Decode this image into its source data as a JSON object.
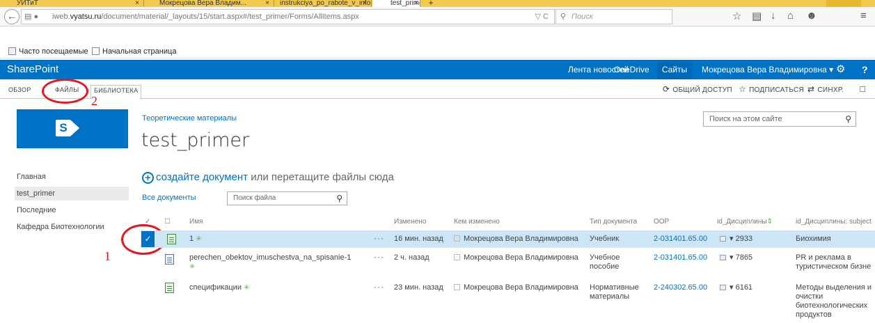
{
  "browser": {
    "tabs": [
      {
        "label": "УИТиТ",
        "close": "×"
      },
      {
        "label": "Мокрецова Вера Владим...",
        "close": "×"
      },
      {
        "label": "instrukciya_po_rabote_v_infor...",
        "close": "×"
      },
      {
        "label": "test_primer - Все докумен...",
        "close": "×",
        "active": true
      }
    ],
    "new_tab": "+",
    "url_prefix": "iweb.",
    "url_host": "vyatsu.ru",
    "url_path": "/document/material/_layouts/15/start.aspx#/test_primer/Forms/AllItems.aspx",
    "reload": "▽ C",
    "search_placeholder": "Поиск",
    "bookmarks": [
      "Часто посещаемые",
      "Начальная страница"
    ]
  },
  "suitebar": {
    "brand": "SharePoint",
    "links": [
      "Лента новостей",
      "OneDrive",
      "Сайты"
    ],
    "user": "Мокрецова Вера Владимировна ▾",
    "help": "?"
  },
  "ribbon": {
    "tabs": [
      "ОБЗОР",
      "ФАЙЛЫ",
      "БИБЛИОТЕКА"
    ],
    "actions": [
      "ОБЩИЙ ДОСТУП",
      "ПОДПИСАТЬСЯ",
      "СИНХР."
    ]
  },
  "annotations": {
    "one": "1",
    "two": "2"
  },
  "site": {
    "breadcrumb": "Теоретические материалы",
    "title": "test_primer",
    "search_placeholder": "Поиск на этом сайте"
  },
  "quick_launch": [
    "Главная",
    "test_primer",
    "Последние",
    "Кафедра Биотехнологии"
  ],
  "upload": {
    "link": "создайте документ",
    "rest": " или перетащите файлы сюда"
  },
  "view": {
    "label": "Все документы",
    "search_placeholder": "Поиск файла"
  },
  "table": {
    "headers": [
      "Имя",
      "Изменено",
      "Кем изменено",
      "Тип документа",
      "ООР",
      "id_Дисциплины",
      "id_Дисциплины: subject"
    ],
    "rows": [
      {
        "name": "1",
        "modified": "16 мин. назад",
        "by": "Мокрецова Вера Владимировна",
        "type": "Учебник",
        "oop": "2-031401.65.00",
        "disc": "2933",
        "subject": "Биохимия",
        "selected": true
      },
      {
        "name": "perechen_obektov_imuschestva_na_spisanie-1",
        "modified": "2 ч. назад",
        "by": "Мокрецова Вера Владимировна",
        "type": "Учебное пособие",
        "oop": "2-031401.65.00",
        "disc": "7865",
        "subject": "PR и реклама в туристическом бизне"
      },
      {
        "name": "спецификации",
        "modified": "23 мин. назад",
        "by": "Мокрецова Вера Владимировна",
        "type": "Нормативные материалы",
        "oop": "2-240302.65.00",
        "disc": "6161",
        "subject": "Методы выделения и очистки биотехнологических продуктов"
      }
    ]
  },
  "colors": {
    "brand_blue": "#0072c6",
    "selected_row": "#cde6f7",
    "annotation_red": "#e4171f",
    "tab_strip": "#f3c94f"
  }
}
